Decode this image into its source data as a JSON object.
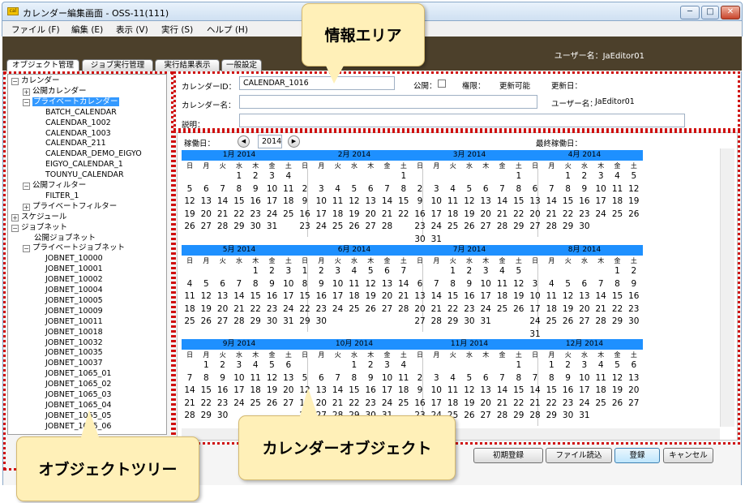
{
  "window": {
    "title": "カレンダー編集画面 - OSS-11(111)",
    "app_icon_label": "cal"
  },
  "window_buttons": [
    "─",
    "□",
    "✕"
  ],
  "menu": [
    "ファイル (F)",
    "編集 (E)",
    "表示 (V)",
    "実行 (S)",
    "ヘルプ (H)"
  ],
  "header": {
    "user": "ユーザー名：JaEditor01"
  },
  "tabs": [
    "オブジェクト管理",
    "ジョブ実行管理",
    "実行結果表示",
    "一般設定"
  ],
  "tree": [
    {
      "label": "カレンダー",
      "level": 0,
      "exp": "⊟"
    },
    {
      "label": "公開カレンダー",
      "level": 1,
      "exp": "⊞"
    },
    {
      "label": "プライベートカレンダー",
      "level": 1,
      "exp": "⊟",
      "selected": true
    },
    {
      "label": "BATCH_CALENDAR",
      "level": 2
    },
    {
      "label": "CALENDAR_1002",
      "level": 2
    },
    {
      "label": "CALENDAR_1003",
      "level": 2
    },
    {
      "label": "CALENDAR_211",
      "level": 2
    },
    {
      "label": "CALENDAR_DEMO_EIGYO",
      "level": 2
    },
    {
      "label": "EIGYO_CALENDAR_1",
      "level": 2
    },
    {
      "label": "TOUNYU_CALENDAR",
      "level": 2
    },
    {
      "label": "公開フィルター",
      "level": 1,
      "exp": "⊟"
    },
    {
      "label": "FILTER_1",
      "level": 2
    },
    {
      "label": "プライベートフィルター",
      "level": 1,
      "exp": "⊞"
    },
    {
      "label": "スケジュール",
      "level": 0,
      "exp": "⊞"
    },
    {
      "label": "ジョブネット",
      "level": 0,
      "exp": "⊟"
    },
    {
      "label": "公開ジョブネット",
      "level": 1
    },
    {
      "label": "プライベートジョブネット",
      "level": 1,
      "exp": "⊟"
    },
    {
      "label": "JOBNET_10000",
      "level": 2
    },
    {
      "label": "JOBNET_10001",
      "level": 2
    },
    {
      "label": "JOBNET_10002",
      "level": 2
    },
    {
      "label": "JOBNET_10004",
      "level": 2
    },
    {
      "label": "JOBNET_10005",
      "level": 2
    },
    {
      "label": "JOBNET_10009",
      "level": 2
    },
    {
      "label": "JOBNET_10011",
      "level": 2
    },
    {
      "label": "JOBNET_10018",
      "level": 2
    },
    {
      "label": "JOBNET_10032",
      "level": 2
    },
    {
      "label": "JOBNET_10035",
      "level": 2
    },
    {
      "label": "JOBNET_10037",
      "level": 2
    },
    {
      "label": "JOBNET_1065_01",
      "level": 2
    },
    {
      "label": "JOBNET_1065_02",
      "level": 2
    },
    {
      "label": "JOBNET_1065_03",
      "level": 2
    },
    {
      "label": "JOBNET_1065_04",
      "level": 2
    },
    {
      "label": "JOBNET_1065_05",
      "level": 2
    },
    {
      "label": "JOBNET_1065_06",
      "level": 2
    }
  ],
  "info": {
    "calendar_id_label": "カレンダーID：",
    "calendar_id_value": "CALENDAR_1016",
    "public_label": "公開：",
    "permission_label": "権限：",
    "permission_value": "更新可能",
    "updated_label": "更新日：",
    "calendar_name_label": "カレンダー名：",
    "calendar_name_value": "",
    "user_label": "ユーザー名：",
    "user_value": "JaEditor01",
    "description_label": "説明：",
    "description_value": ""
  },
  "calendar": {
    "start_label": "稼働日：",
    "year": "2014",
    "last_label": "最終稼働日：",
    "weekdays": [
      "日",
      "月",
      "火",
      "水",
      "木",
      "金",
      "土"
    ],
    "months": [
      {
        "label": "1月 2014",
        "first": 3,
        "days": 31
      },
      {
        "label": "2月 2014",
        "first": 6,
        "days": 28
      },
      {
        "label": "3月 2014",
        "first": 6,
        "days": 31
      },
      {
        "label": "4月 2014",
        "first": 2,
        "days": 30
      },
      {
        "label": "5月 2014",
        "first": 4,
        "days": 31
      },
      {
        "label": "6月 2014",
        "first": 0,
        "days": 30
      },
      {
        "label": "7月 2014",
        "first": 2,
        "days": 31
      },
      {
        "label": "8月 2014",
        "first": 5,
        "days": 31
      },
      {
        "label": "9月 2014",
        "first": 1,
        "days": 30
      },
      {
        "label": "10月 2014",
        "first": 3,
        "days": 31
      },
      {
        "label": "11月 2014",
        "first": 6,
        "days": 30
      },
      {
        "label": "12月 2014",
        "first": 1,
        "days": 31
      }
    ]
  },
  "buttons": {
    "reset": "初期登録",
    "file_load": "ファイル読込",
    "register": "登録",
    "cancel": "キャンセル"
  },
  "callouts": {
    "info_area": "情報エリア",
    "object_tree": "オブジェクトツリー",
    "calendar_object": "カレンダーオブジェクト"
  },
  "colors": {
    "header_bg": "#4c402b",
    "month_header": "#1e90ff",
    "annotation_border": "#d01010",
    "callout_bg": "#fff0b8"
  }
}
